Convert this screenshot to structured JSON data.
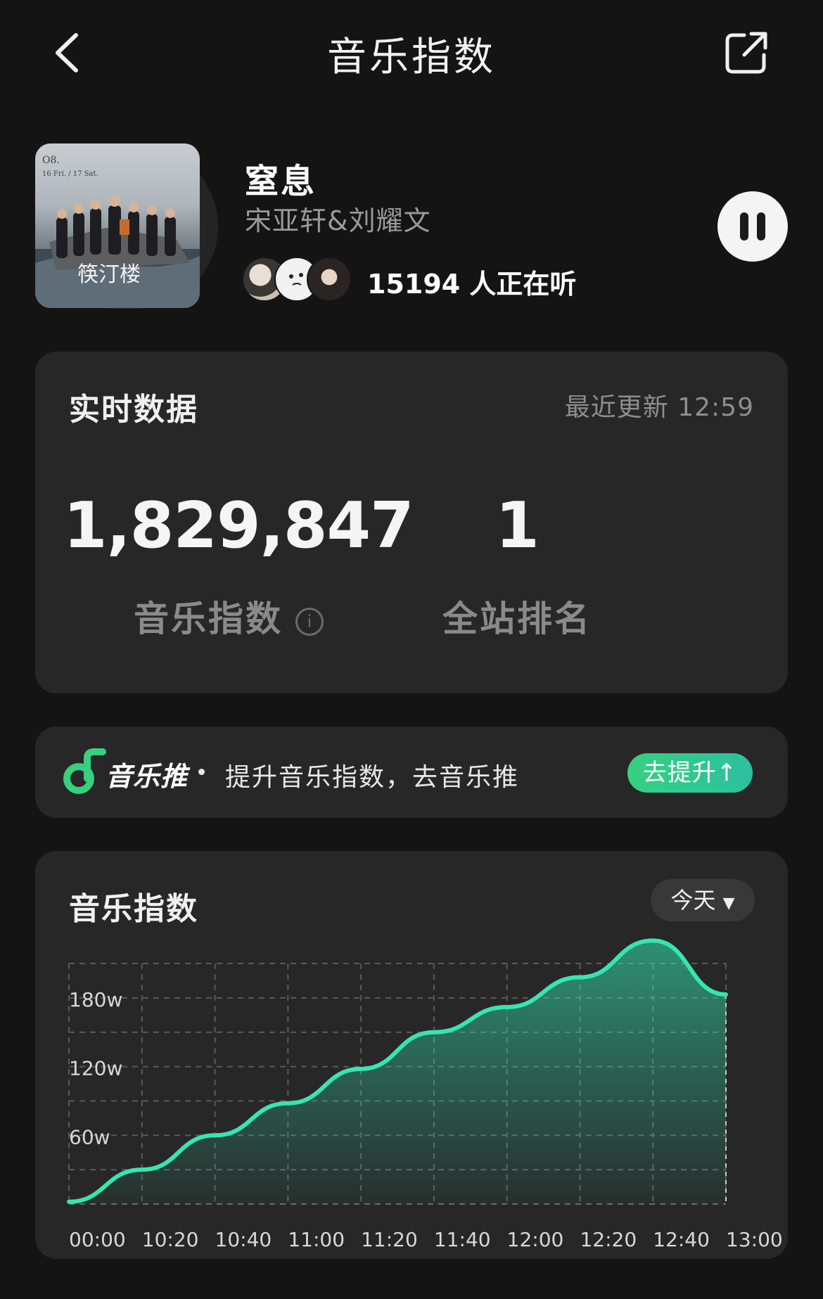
{
  "header": {
    "title": "音乐指数",
    "back_icon": "chevron-left-icon",
    "share_icon": "share-external-icon"
  },
  "song": {
    "title": "窒息",
    "artist": "宋亚轩&刘耀文",
    "listeners_text": "15194 人正在听",
    "cover_text": "筷汀楼",
    "pause_icon": "pause-icon"
  },
  "realtime": {
    "title": "实时数据",
    "updated": "最近更新 12:59",
    "index_value": "1,829,847",
    "index_label": "音乐指数",
    "rank_value": "1",
    "rank_label": "全站排名",
    "info_glyph": "i"
  },
  "promo": {
    "brand": "音乐推",
    "text": "提升音乐指数，去音乐推",
    "button": "去提升↑",
    "accent": "#36d07f"
  },
  "chart_section": {
    "title": "音乐指数",
    "period": "今天"
  },
  "chart_data": {
    "type": "area",
    "x": [
      "00:00",
      "10:20",
      "10:40",
      "11:00",
      "11:20",
      "11:40",
      "12:00",
      "12:20",
      "12:40",
      "13:00"
    ],
    "series": [
      {
        "values": [
          2,
          30,
          60,
          88,
          118,
          150,
          172,
          198,
          230,
          182.98
        ]
      }
    ],
    "y_ticks": [
      60,
      120,
      180
    ],
    "y_tick_labels": [
      "60w",
      "120w",
      "180w"
    ],
    "ylim": [
      0,
      210
    ],
    "grid": true,
    "line_color": "#35e6b2",
    "xlabel": "",
    "ylabel": ""
  }
}
